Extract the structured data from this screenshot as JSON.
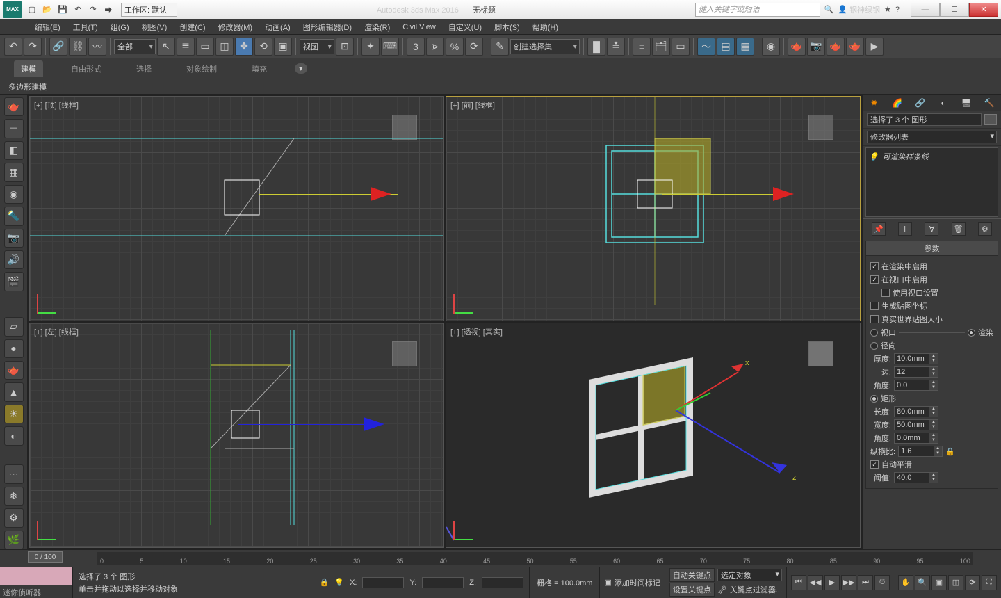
{
  "titlebar": {
    "logo": "MAX",
    "workspace_label": "工作区: 默认",
    "app": "Autodesk 3ds Max 2016",
    "doc": "无标题",
    "search_placeholder": "健入关键字或短语",
    "account": "钢神绿钢"
  },
  "menu": [
    "编辑(E)",
    "工具(T)",
    "组(G)",
    "视图(V)",
    "创建(C)",
    "修改器(M)",
    "动画(A)",
    "图形编辑器(D)",
    "渲染(R)",
    "Civil View",
    "自定义(U)",
    "脚本(S)",
    "帮助(H)"
  ],
  "maintb": {
    "filter": "全部",
    "refcoord": "视图",
    "selset": "创建选择集"
  },
  "ribbon": {
    "tabs": [
      "建模",
      "自由形式",
      "选择",
      "对象绘制",
      "填充"
    ],
    "sub": "多边形建模"
  },
  "viewports": {
    "top": "[+] [顶] [线框]",
    "front": "[+] [前] [线框]",
    "left": "[+] [左] [线框]",
    "persp": "[+] [透视] [真实]"
  },
  "cmdpanel": {
    "sel_info": "选择了 3 个 图形",
    "modlist_label": "修改器列表",
    "mod_item": "可渲染样条线",
    "rollout_params": "参数",
    "enable_render": "在渲染中启用",
    "enable_vp": "在视口中启用",
    "use_vp_set": "使用视口设置",
    "gen_uv": "生成贴图坐标",
    "real_world": "真实世界贴图大小",
    "viewport": "视口",
    "render": "渲染",
    "radial": "径向",
    "thickness": "厚度:",
    "thickness_v": "10.0mm",
    "sides": "边:",
    "sides_v": "12",
    "angle": "角度:",
    "angle_v": "0.0",
    "rect": "矩形",
    "length": "长度:",
    "length_v": "80.0mm",
    "width": "宽度:",
    "width_v": "50.0mm",
    "angle2": "角度:",
    "angle2_v": "0.0mm",
    "aspect": "纵横比:",
    "aspect_v": "1.6",
    "autosmooth": "自动平滑",
    "threshold": "阈值:",
    "threshold_v": "40.0"
  },
  "timeline": {
    "pos": "0 / 100",
    "ticks": [
      "0",
      "5",
      "10",
      "15",
      "20",
      "25",
      "30",
      "35",
      "40",
      "45",
      "50",
      "55",
      "60",
      "65",
      "70",
      "75",
      "80",
      "85",
      "90",
      "95",
      "100"
    ]
  },
  "status": {
    "mini": "迷你侦听器",
    "sel": "选择了 3 个 图形",
    "hint": "单击并拖动以选择并移动对象",
    "x": "X:",
    "y": "Y:",
    "z": "Z:",
    "grid": "栅格 = 100.0mm",
    "autokey": "自动关键点",
    "setkey": "设置关键点",
    "keyfilter_dd": "选定对象",
    "keyfilter": "关键点过滤器...",
    "addtime": "添加时间标记"
  }
}
